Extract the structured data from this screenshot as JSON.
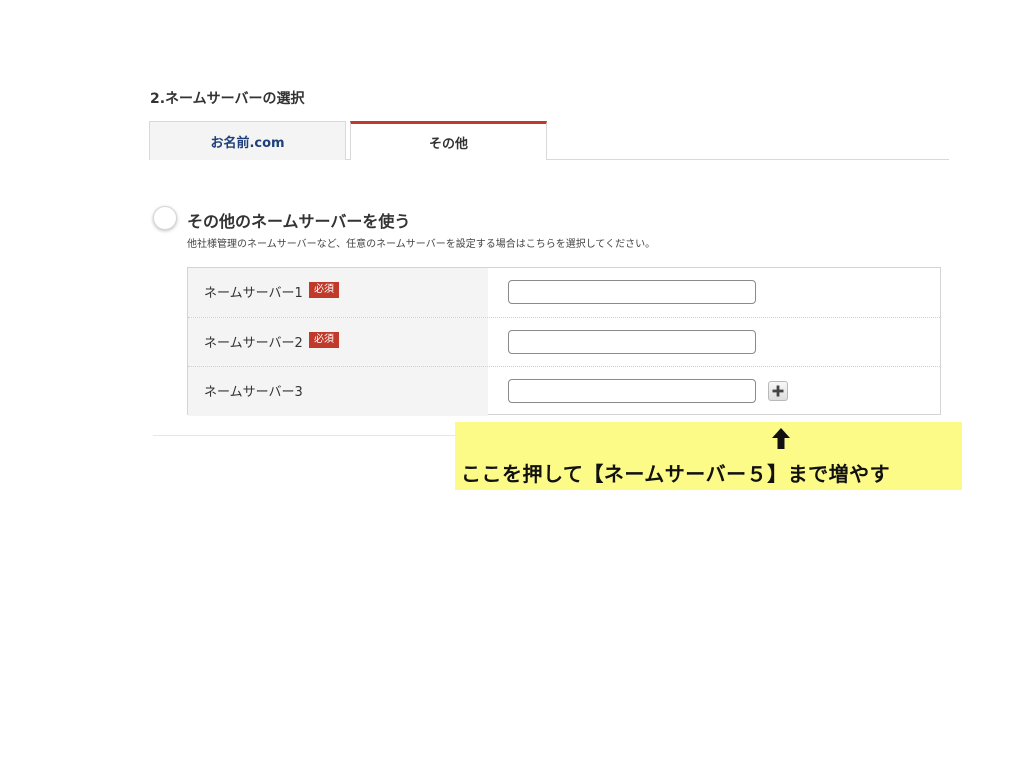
{
  "section": {
    "title": "2.ネームサーバーの選択"
  },
  "tabs": [
    {
      "label": "お名前.com",
      "active": false
    },
    {
      "label": "その他",
      "active": true
    }
  ],
  "option": {
    "title": "その他のネームサーバーを使う",
    "description": "他社様管理のネームサーバーなど、任意のネームサーバーを設定する場合はこちらを選択してください。",
    "selected": false
  },
  "nameservers": [
    {
      "label": "ネームサーバー1",
      "badge": "必須",
      "value": ""
    },
    {
      "label": "ネームサーバー2",
      "badge": "必須",
      "value": ""
    },
    {
      "label": "ネームサーバー3",
      "value": ""
    }
  ],
  "add_button": {
    "icon": "plus-icon"
  },
  "annotation": {
    "arrow_icon": "arrow-up-icon",
    "text": "ここを押して【ネームサーバー５】まで増やす",
    "background": "#fdfb88"
  },
  "colors": {
    "accent": "#c0392b",
    "tab_link": "#1f3f7a"
  }
}
